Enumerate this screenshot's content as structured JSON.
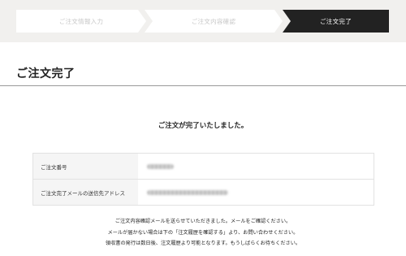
{
  "steps": [
    {
      "label": "ご注文情報入力",
      "state": "done"
    },
    {
      "label": "ご注文内容確認",
      "state": "done"
    },
    {
      "label": "ご注文完了",
      "state": "current"
    }
  ],
  "page": {
    "title": "ご注文完了",
    "message": "ご注文が完了いたしました。"
  },
  "info": {
    "order_number_label": "ご注文番号",
    "email_label": "ご注文完了メールの送信先アドレス"
  },
  "notes": [
    "ご注文内容確認メールを送らせていただきました。メールをご確認ください。",
    "メールが届かない場合は下の「注文履歴を確認する」より、お問い合わせください。",
    "領収書の発行は数日後、注文履歴より可能となります。もうしばらくお待ちください。"
  ],
  "colors": {
    "active_step_bg": "#222222",
    "inactive_step_text": "#c8c8c8",
    "stepbar_bg": "#f1f0ee"
  }
}
